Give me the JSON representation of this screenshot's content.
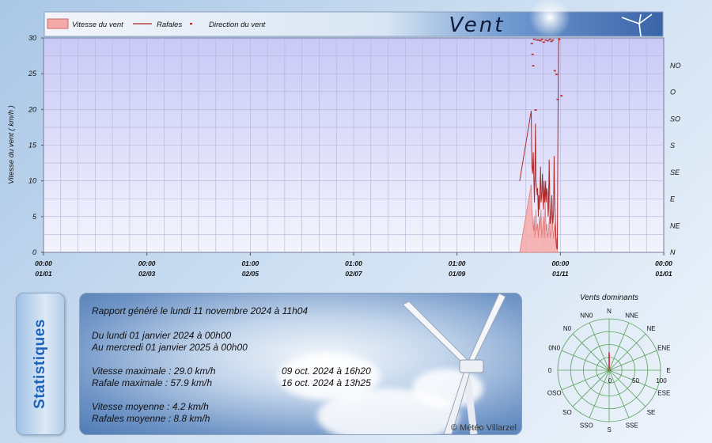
{
  "chart_data": {
    "type": "line",
    "title": "Vent",
    "legend": [
      "Vitesse du vent",
      "Rafales",
      "Direction du vent"
    ],
    "ylabel": "Vitesse du vent ( km/h )",
    "ylim": [
      0,
      30
    ],
    "yticks": [
      "0",
      "5",
      "10",
      "15",
      "20",
      "25",
      "30"
    ],
    "direction_ticks": [
      "N",
      "NE",
      "E",
      "SE",
      "S",
      "SO",
      "O",
      "NO"
    ],
    "x_ticks": [
      {
        "time": "00:00",
        "date": "01/01"
      },
      {
        "time": "00:00",
        "date": "02/03"
      },
      {
        "time": "01:00",
        "date": "02/05"
      },
      {
        "time": "01:00",
        "date": "02/07"
      },
      {
        "time": "01:00",
        "date": "01/09"
      },
      {
        "time": "00:00",
        "date": "01/11"
      },
      {
        "time": "00:00",
        "date": "01/01"
      }
    ],
    "series": [
      {
        "name": "Vitesse du vent",
        "x_day": [
          0,
          6.8,
          7.2,
          7.8,
          8.2,
          8.5,
          9,
          9.6,
          10,
          10.6,
          11,
          11.6,
          12,
          12.6,
          13,
          13.4,
          14,
          14.6,
          15,
          15.6,
          16,
          16.4,
          17,
          17.6,
          18,
          18.5,
          19,
          19.6,
          20,
          20.5,
          21,
          21.6,
          22,
          22.2,
          22.8
        ],
        "values": [
          0,
          9.5,
          6,
          4,
          3,
          5,
          2,
          6,
          3,
          4,
          2,
          5,
          3,
          6,
          2,
          3,
          5,
          2,
          7,
          3,
          4,
          2,
          3,
          5,
          2,
          3,
          6,
          3,
          2,
          4,
          3,
          1,
          2,
          0,
          0
        ]
      },
      {
        "name": "Rafales",
        "x_day": [
          0,
          6.8,
          7.2,
          7.6,
          8,
          8.4,
          8.7,
          9,
          9.3,
          9.6,
          10,
          10.3,
          10.6,
          11,
          11.3,
          11.6,
          12,
          12.3,
          12.6,
          13,
          13.4,
          13.8,
          14,
          14.4,
          14.8,
          15,
          15.3,
          15.6,
          16,
          16.4,
          16.8,
          17,
          17.4,
          17.8,
          18,
          18.4,
          18.8,
          19,
          19.3,
          19.6,
          20,
          20.3,
          20.6,
          21,
          21.4,
          21.6,
          22,
          22.2,
          22.6,
          22.9,
          23.2
        ],
        "values": [
          10,
          19.8,
          12,
          11,
          14,
          10,
          7,
          11,
          18,
          10,
          9,
          8,
          9,
          5,
          8,
          6,
          9,
          12,
          7,
          8,
          11,
          7,
          6,
          10,
          7,
          8,
          10,
          7,
          9,
          8,
          5,
          6,
          13,
          6,
          4,
          5,
          7,
          8,
          5,
          4,
          6,
          13.5,
          8,
          5,
          2,
          1,
          0.5,
          0.5,
          18,
          29,
          30
        ]
      }
    ],
    "series_style": {
      "Vitesse du vent": "#f4a9a9",
      "Rafales": "#b02a2a",
      "Direction du vent": "#b02a2a"
    }
  },
  "rose": {
    "title": "Vents dominants",
    "directions": [
      "N",
      "NNE",
      "NE",
      "ENE",
      "E",
      "ESE",
      "SE",
      "SSE",
      "S",
      "SSO",
      "SO",
      "OSO",
      "0",
      "0N0",
      "N0",
      "NN0"
    ],
    "scale_labels": [
      "0",
      "50",
      "100"
    ],
    "values": [
      30,
      0,
      0,
      0,
      3,
      0,
      0,
      0,
      0,
      0,
      0,
      0,
      2,
      0,
      0,
      0
    ]
  },
  "statistics": {
    "tab_label": "Statistiques",
    "report_date": "Rapport généré le lundi 11 novembre 2024 à 11h04",
    "period_start": "Du lundi 01 janvier 2024 à 00h00",
    "period_end": "Au mercredi 01 janvier 2025 à 00h00",
    "max_speed": "Vitesse maximale : 29.0 km/h",
    "max_speed_date": "09 oct. 2024 à 16h20",
    "max_gust": "Rafale maximale : 57.9 km/h",
    "max_gust_date": "16 oct. 2024 à 13h25",
    "avg_speed": "Vitesse moyenne : 4.2 km/h",
    "avg_gust": "Rafales moyenne : 8.8 km/h",
    "copyright": "© Météo Villarzel"
  }
}
